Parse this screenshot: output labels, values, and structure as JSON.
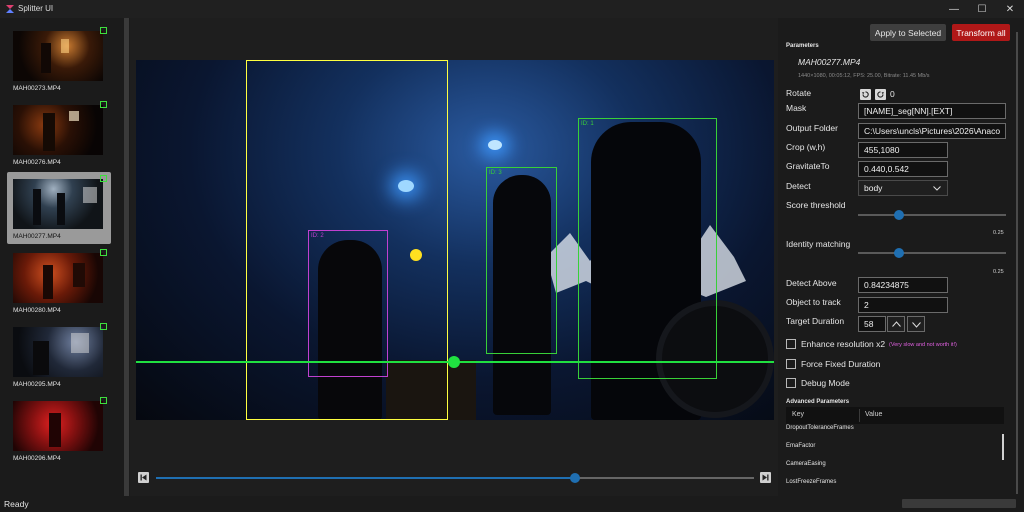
{
  "window": {
    "title": "Splitter UI",
    "minimize": "—",
    "maximize": "☐",
    "close": "✕"
  },
  "sidebar": {
    "items": [
      {
        "label": "MAH00273.MP4",
        "selected": false
      },
      {
        "label": "MAH00276.MP4",
        "selected": false
      },
      {
        "label": "MAH00277.MP4",
        "selected": true
      },
      {
        "label": "MAH00280.MP4",
        "selected": false
      },
      {
        "label": "MAH00295.MP4",
        "selected": false
      },
      {
        "label": "MAH00296.MP4",
        "selected": false
      }
    ]
  },
  "preview": {
    "detections": [
      {
        "id_label": "ID: 2",
        "color": "#c040d0"
      },
      {
        "id_label": "ID: 3",
        "color": "#38d038"
      },
      {
        "id_label": "ID: 1",
        "color": "#38d038"
      }
    ],
    "crop_box_color": "#ffff40",
    "gravity_color": "#ffe020",
    "track_line_color": "#20e040",
    "timeline_position": 0.7
  },
  "toolbar": {
    "apply_label": "Apply to Selected",
    "transform_label": "Transform all"
  },
  "params": {
    "heading": "Parameters",
    "filename": "MAH00277.MP4",
    "info": "1440×1080, 00:05:12, FPS: 25.00, Bitrate: 11.45 Mb/s",
    "rotate_label": "Rotate",
    "rotate_value": "0",
    "mask_label": "Mask",
    "mask_value": "[NAME]_seg[NN].[EXT]",
    "output_label": "Output Folder",
    "output_value": "C:\\Users\\uncls\\Pictures\\2026\\Anaco",
    "crop_label": "Crop (w,h)",
    "crop_value": "455,1080",
    "gravity_label": "GravitateTo",
    "gravity_value": "0.440,0.542",
    "detect_label": "Detect",
    "detect_value": "body",
    "score_label": "Score threshold",
    "score_value": "0.25",
    "score_position": 0.28,
    "identity_label": "Identity matching",
    "identity_value": "0.25",
    "identity_position": 0.28,
    "detect_above_label": "Detect Above",
    "detect_above_value": "0.84234875",
    "object_label": "Object to track",
    "object_value": "2",
    "target_label": "Target Duration",
    "target_value": "58",
    "enhance_label": "Enhance resolution x2",
    "enhance_note": "(Very slow and not worth it!)",
    "force_label": "Force Fixed Duration",
    "debug_label": "Debug Mode"
  },
  "advanced": {
    "heading": "Advanced Parameters",
    "col_key": "Key",
    "col_value": "Value",
    "rows": [
      "DropoutToleranceFrames",
      "EmaFactor",
      "CameraEasing",
      "LostFreezeFrames"
    ]
  },
  "status": {
    "text": "Ready"
  },
  "colors": {
    "accent": "#1f6fb2",
    "danger": "#b01818",
    "note": "#e060e0"
  }
}
